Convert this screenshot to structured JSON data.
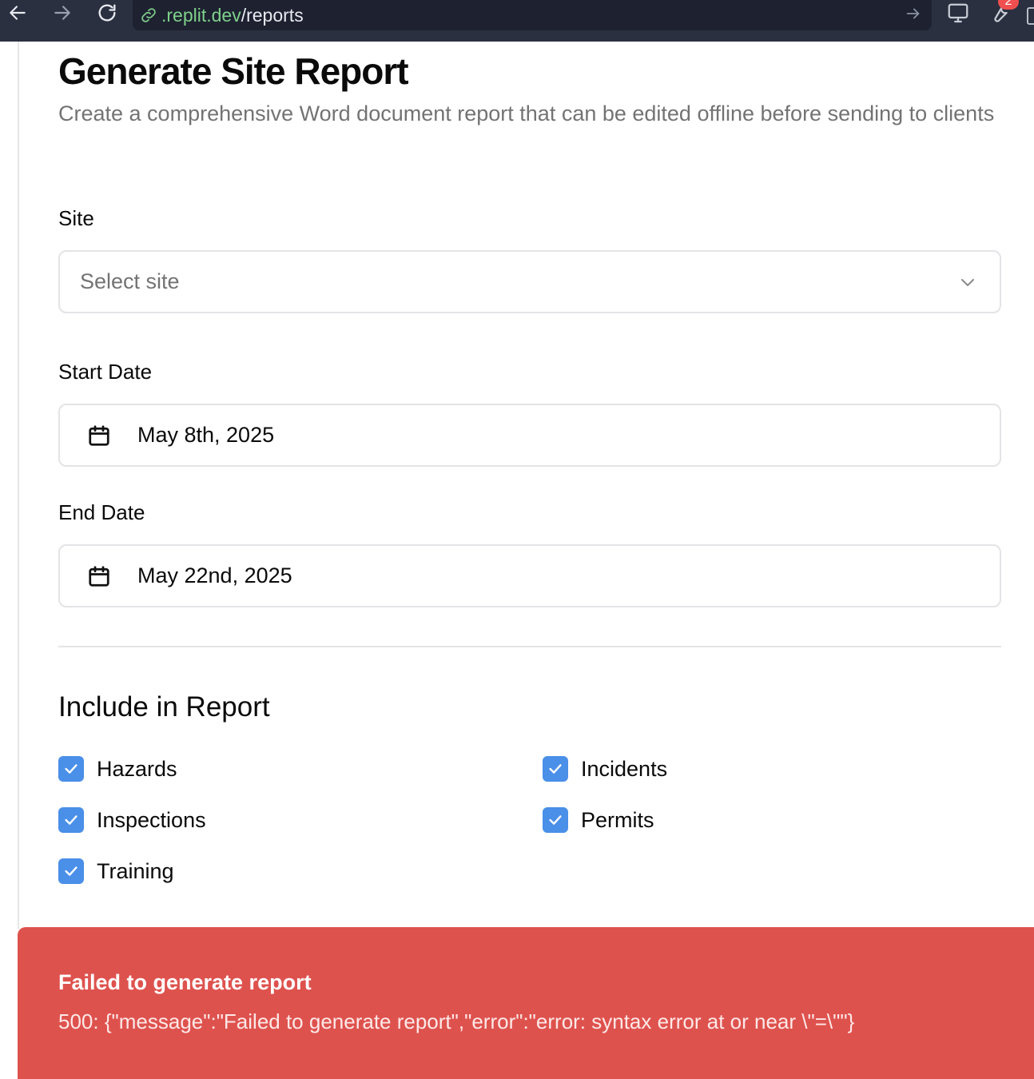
{
  "browser": {
    "url_host": ".replit.dev",
    "url_path": "/reports",
    "notification_count": "2"
  },
  "page": {
    "title": "Generate Site Report",
    "subtitle": "Create a comprehensive Word document report that can be edited offline before sending to clients"
  },
  "form": {
    "site": {
      "label": "Site",
      "placeholder": "Select site"
    },
    "start_date": {
      "label": "Start Date",
      "value": "May 8th, 2025"
    },
    "end_date": {
      "label": "End Date",
      "value": "May 22nd, 2025"
    }
  },
  "include": {
    "title": "Include in Report",
    "items": [
      {
        "label": "Hazards",
        "checked": true
      },
      {
        "label": "Incidents",
        "checked": true
      },
      {
        "label": "Inspections",
        "checked": true
      },
      {
        "label": "Permits",
        "checked": true
      },
      {
        "label": "Training",
        "checked": true
      }
    ]
  },
  "toast": {
    "title": "Failed to generate report",
    "message": "500: {\"message\":\"Failed to generate report\",\"error\":\"error: syntax error at or near \\\"=\\\"\"}"
  },
  "colors": {
    "checkbox": "#4a8fe8",
    "toast_bg": "#de524e",
    "browser_bar": "#2b3040",
    "url_host": "#7fd18b"
  }
}
